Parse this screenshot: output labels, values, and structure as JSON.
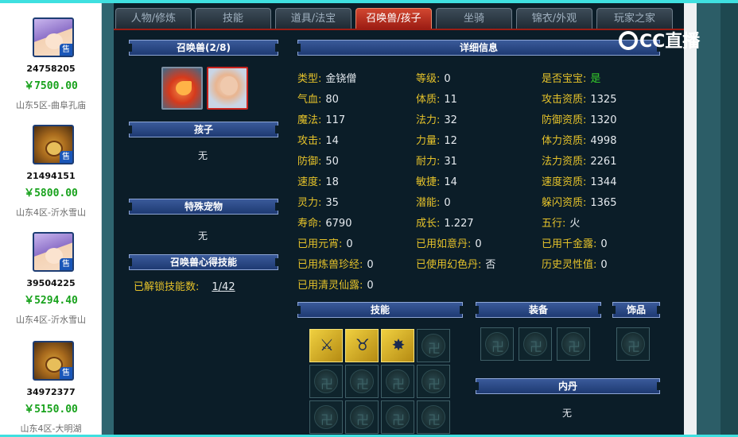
{
  "listings": [
    {
      "id": "24758205",
      "price": "￥7500.00",
      "server": "山东5区-曲阜孔庙",
      "avatar": "female-character-avatar",
      "sale_badge": "售"
    },
    {
      "id": "21494151",
      "price": "￥5800.00",
      "server": "山东4区-沂水雪山",
      "avatar": "lion-character-avatar",
      "sale_badge": "售"
    },
    {
      "id": "39504225",
      "price": "￥5294.40",
      "server": "山东4区-沂水雪山",
      "avatar": "female-character-avatar",
      "sale_badge": "售"
    },
    {
      "id": "34972377",
      "price": "￥5150.00",
      "server": "山东4区-大明湖",
      "avatar": "lion-character-avatar",
      "sale_badge": "售"
    }
  ],
  "tabs": [
    {
      "label": "人物/修炼",
      "active": false
    },
    {
      "label": "技能",
      "active": false
    },
    {
      "label": "道具/法宝",
      "active": false
    },
    {
      "label": "召唤兽/孩子",
      "active": true
    },
    {
      "label": "坐骑",
      "active": false
    },
    {
      "label": "锦衣/外观",
      "active": false
    },
    {
      "label": "玩家之家",
      "active": false
    }
  ],
  "left_panel": {
    "summon_header": "召唤兽(2/8)",
    "child_header": "孩子",
    "child_value": "无",
    "special_pet_header": "特殊宠物",
    "special_pet_value": "无",
    "skill_insight_header": "召唤兽心得技能",
    "unlocked_label": "已解锁技能数:",
    "unlocked_value": "1/42"
  },
  "details": {
    "header": "详细信息",
    "col1": [
      {
        "k": "类型:",
        "v": "金铙僧"
      },
      {
        "k": "气血:",
        "v": "80"
      },
      {
        "k": "魔法:",
        "v": "117"
      },
      {
        "k": "攻击:",
        "v": "14"
      },
      {
        "k": "防御:",
        "v": "50"
      },
      {
        "k": "速度:",
        "v": "18"
      },
      {
        "k": "灵力:",
        "v": "35"
      },
      {
        "k": "寿命:",
        "v": "6790"
      },
      {
        "k": "已用元宵:",
        "v": "0"
      },
      {
        "k": "已用炼兽珍经:",
        "v": "0"
      },
      {
        "k": "已用清灵仙露:",
        "v": "0"
      }
    ],
    "col2": [
      {
        "k": "等级:",
        "v": "0"
      },
      {
        "k": "体质:",
        "v": "11"
      },
      {
        "k": "法力:",
        "v": "32"
      },
      {
        "k": "力量:",
        "v": "12"
      },
      {
        "k": "耐力:",
        "v": "31"
      },
      {
        "k": "敏捷:",
        "v": "14"
      },
      {
        "k": "潜能:",
        "v": "0"
      },
      {
        "k": "成长:",
        "v": "1.227"
      },
      {
        "k": "已用如意丹:",
        "v": "0"
      },
      {
        "k": "已使用幻色丹:",
        "v": "否"
      }
    ],
    "col3": [
      {
        "k": "是否宝宝:",
        "v": "是"
      },
      {
        "k": "攻击资质:",
        "v": "1325"
      },
      {
        "k": "防御资质:",
        "v": "1320"
      },
      {
        "k": "体力资质:",
        "v": "4998"
      },
      {
        "k": "法力资质:",
        "v": "2261"
      },
      {
        "k": "速度资质:",
        "v": "1344"
      },
      {
        "k": "躲闪资质:",
        "v": "1365"
      },
      {
        "k": "五行:",
        "v": "火"
      },
      {
        "k": "已用千金露:",
        "v": "0"
      },
      {
        "k": "历史灵性值:",
        "v": "0"
      }
    ]
  },
  "sections": {
    "skills": "技能",
    "equipment": "装备",
    "accessory": "饰品",
    "inner_pill": "内丹",
    "inner_pill_value": "无"
  },
  "skill_icons": [
    "crossed-swords-skill-icon",
    "serpent-skill-icon",
    "sun-burst-skill-icon"
  ],
  "watermark": "CC直播",
  "colors": {
    "label": "#e5c22a",
    "value": "#e6ebf0",
    "price": "#18a21c",
    "active_tab": "#c0301f",
    "header": "#2a4a88"
  }
}
